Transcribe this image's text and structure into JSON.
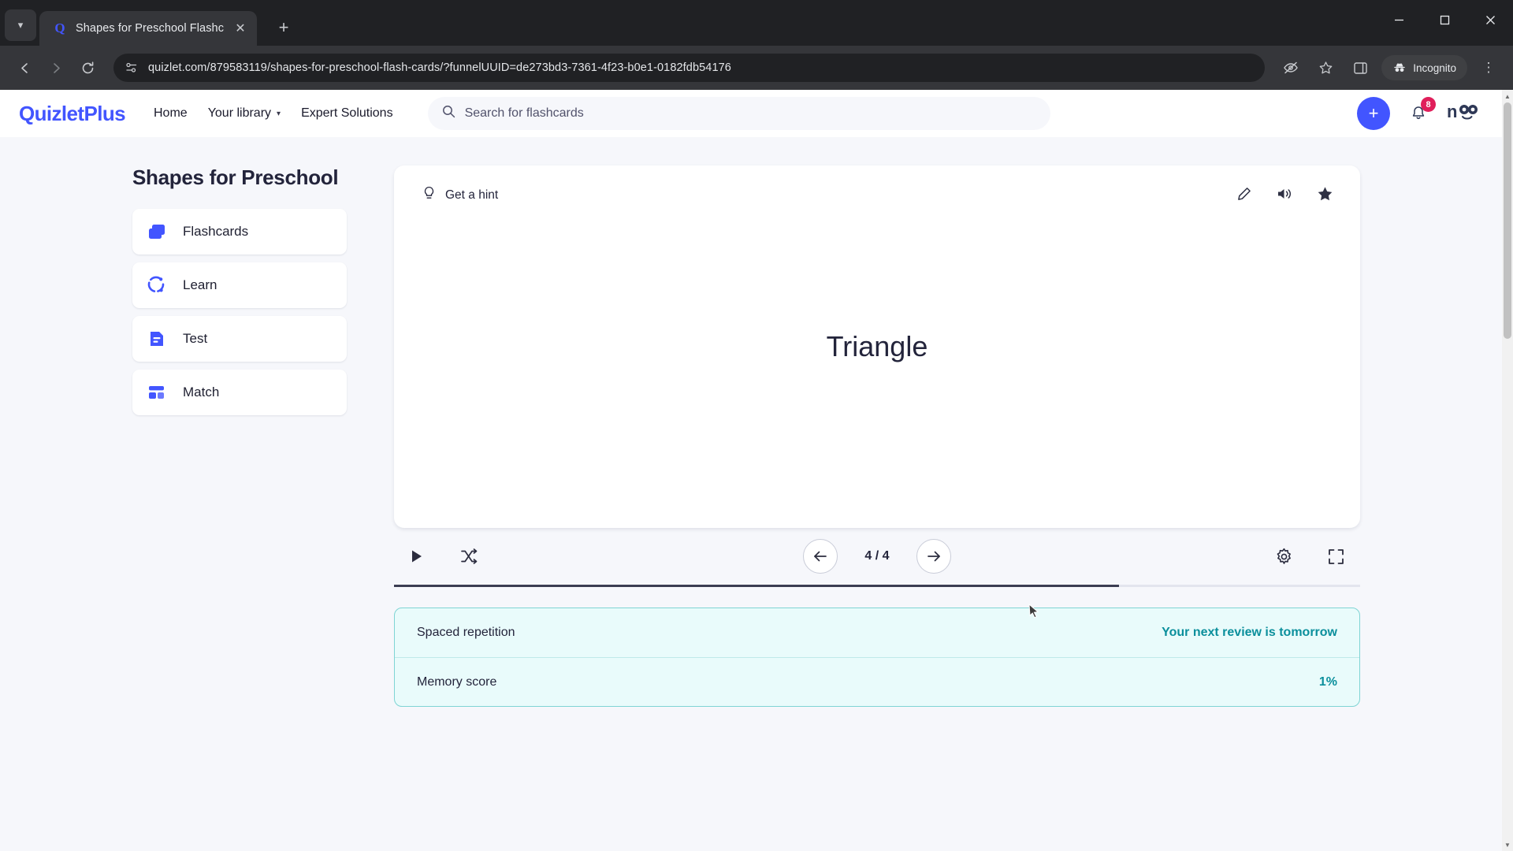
{
  "browser": {
    "tab": {
      "title": "Shapes for Preschool Flashcard",
      "favicon": "quizlet-q-icon",
      "close": "✕"
    },
    "new_tab": "+",
    "window": {
      "minimize": "—",
      "maximize": "☐",
      "close": "✕"
    },
    "nav": {
      "back": "←",
      "forward": "→",
      "reload": "↻"
    },
    "url": "quizlet.com/879583119/shapes-for-preschool-flash-cards/?funnelUUID=de273bd3-7361-4f23-b0e1-0182fdb54176",
    "incognito_label": "Incognito",
    "menu": "⋮"
  },
  "header": {
    "logo_quizlet": "Quizlet",
    "logo_plus": "Plus",
    "nav_items": [
      {
        "label": "Home",
        "has_caret": false
      },
      {
        "label": "Your library",
        "has_caret": true
      },
      {
        "label": "Expert Solutions",
        "has_caret": false
      }
    ],
    "search_placeholder": "Search for flashcards",
    "create_label": "+",
    "notification_count": "8",
    "avatar_text": "n"
  },
  "sidebar": {
    "set_title": "Shapes for Preschool",
    "modes": [
      {
        "label": "Flashcards",
        "icon": "cards-icon"
      },
      {
        "label": "Learn",
        "icon": "learn-circle-icon"
      },
      {
        "label": "Test",
        "icon": "test-document-icon"
      },
      {
        "label": "Match",
        "icon": "match-tiles-icon"
      }
    ]
  },
  "flashcard": {
    "hint_label": "Get a hint",
    "hint_icon": "lightbulb-icon",
    "tools": [
      {
        "icon": "edit-pencil-icon"
      },
      {
        "icon": "audio-speaker-icon"
      },
      {
        "icon": "star-icon"
      }
    ],
    "term": "Triangle"
  },
  "controls": {
    "play_icon": "play-icon",
    "shuffle_icon": "shuffle-icon",
    "prev_icon": "arrow-left-icon",
    "next_icon": "arrow-right-icon",
    "counter": "4 / 4",
    "settings_icon": "gear-icon",
    "fullscreen_icon": "fullscreen-icon",
    "progress_percent": 75
  },
  "spaced_repetition": {
    "rows": [
      {
        "label": "Spaced repetition",
        "value": "Your next review is tomorrow"
      },
      {
        "label": "Memory score",
        "value": "1%"
      }
    ]
  },
  "colors": {
    "brand_blue": "#4255ff",
    "badge_red": "#e01e5a",
    "srs_bg": "#e9fbfb",
    "srs_border": "#7fd4d4",
    "srs_accent": "#0b8f9c"
  }
}
